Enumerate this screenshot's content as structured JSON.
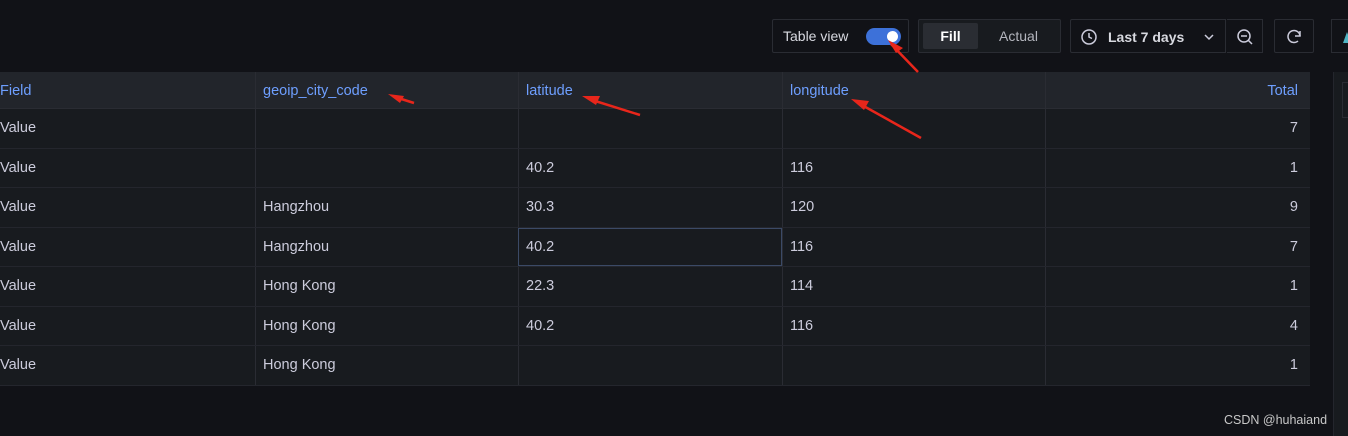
{
  "toolbar": {
    "table_view_label": "Table view",
    "table_view_on": true,
    "fill_label": "Fill",
    "actual_label": "Actual",
    "time_range_label": "Last 7 days"
  },
  "table": {
    "columns": [
      "Field",
      "geoip_city_code",
      "latitude",
      "longitude",
      "Total"
    ],
    "rows": [
      [
        "Value",
        "",
        "",
        "",
        "7"
      ],
      [
        "Value",
        "",
        "40.2",
        "116",
        "1"
      ],
      [
        "Value",
        "Hangzhou",
        "30.3",
        "120",
        "9"
      ],
      [
        "Value",
        "Hangzhou",
        "40.2",
        "116",
        "7"
      ],
      [
        "Value",
        "Hong Kong",
        "22.3",
        "114",
        "1"
      ],
      [
        "Value",
        "Hong Kong",
        "40.2",
        "116",
        "4"
      ],
      [
        "Value",
        "Hong Kong",
        "",
        "",
        "1"
      ]
    ]
  },
  "colors": {
    "accent": "#3d71d9",
    "header_text": "#6e9fff",
    "annotation_arrow": "#e8261b"
  },
  "watermark": "CSDN @huhaiand"
}
